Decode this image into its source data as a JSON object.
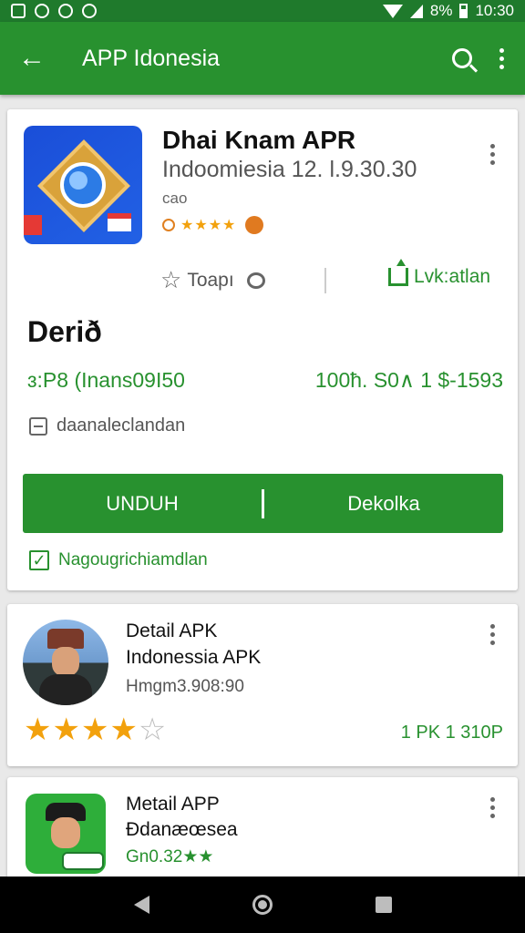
{
  "status_bar": {
    "battery": "8%",
    "time": "10:30"
  },
  "app_bar": {
    "title": "APP Idonesia"
  },
  "app": {
    "name": "Dhai Knam APR",
    "subtitle": "Indoomiesia 12. l.9.30.30",
    "developer": "cao",
    "rating_stars": "★★★★"
  },
  "actions": {
    "rate_label": "Toapı",
    "share_label": "Lvk:atlan"
  },
  "details": {
    "section_title": "Derið",
    "info_left": "ɜ:P8 (Inans09I50",
    "info_right": "100ћ. S0∧ 1 $-1593",
    "download_row": "daanaleclandan"
  },
  "buttons": {
    "primary": "UNDUH",
    "secondary": "Dekolka"
  },
  "checkbox": {
    "label": "Nagougrichiamdlan",
    "checked": true
  },
  "list": [
    {
      "title1": "Detail APK",
      "title2": "Indonessia APK",
      "version": "Hmgm3.908:90",
      "stars_filled": 4,
      "stars_total": 5,
      "right_text": "1 PK 1 310P"
    },
    {
      "title1": "Metail APP",
      "title2": "Ðdanæœsea",
      "rating": "Gn0.32★★"
    }
  ],
  "colors": {
    "primary": "#28912f",
    "status_bar": "#1f7a2c",
    "star": "#f2a10d"
  }
}
